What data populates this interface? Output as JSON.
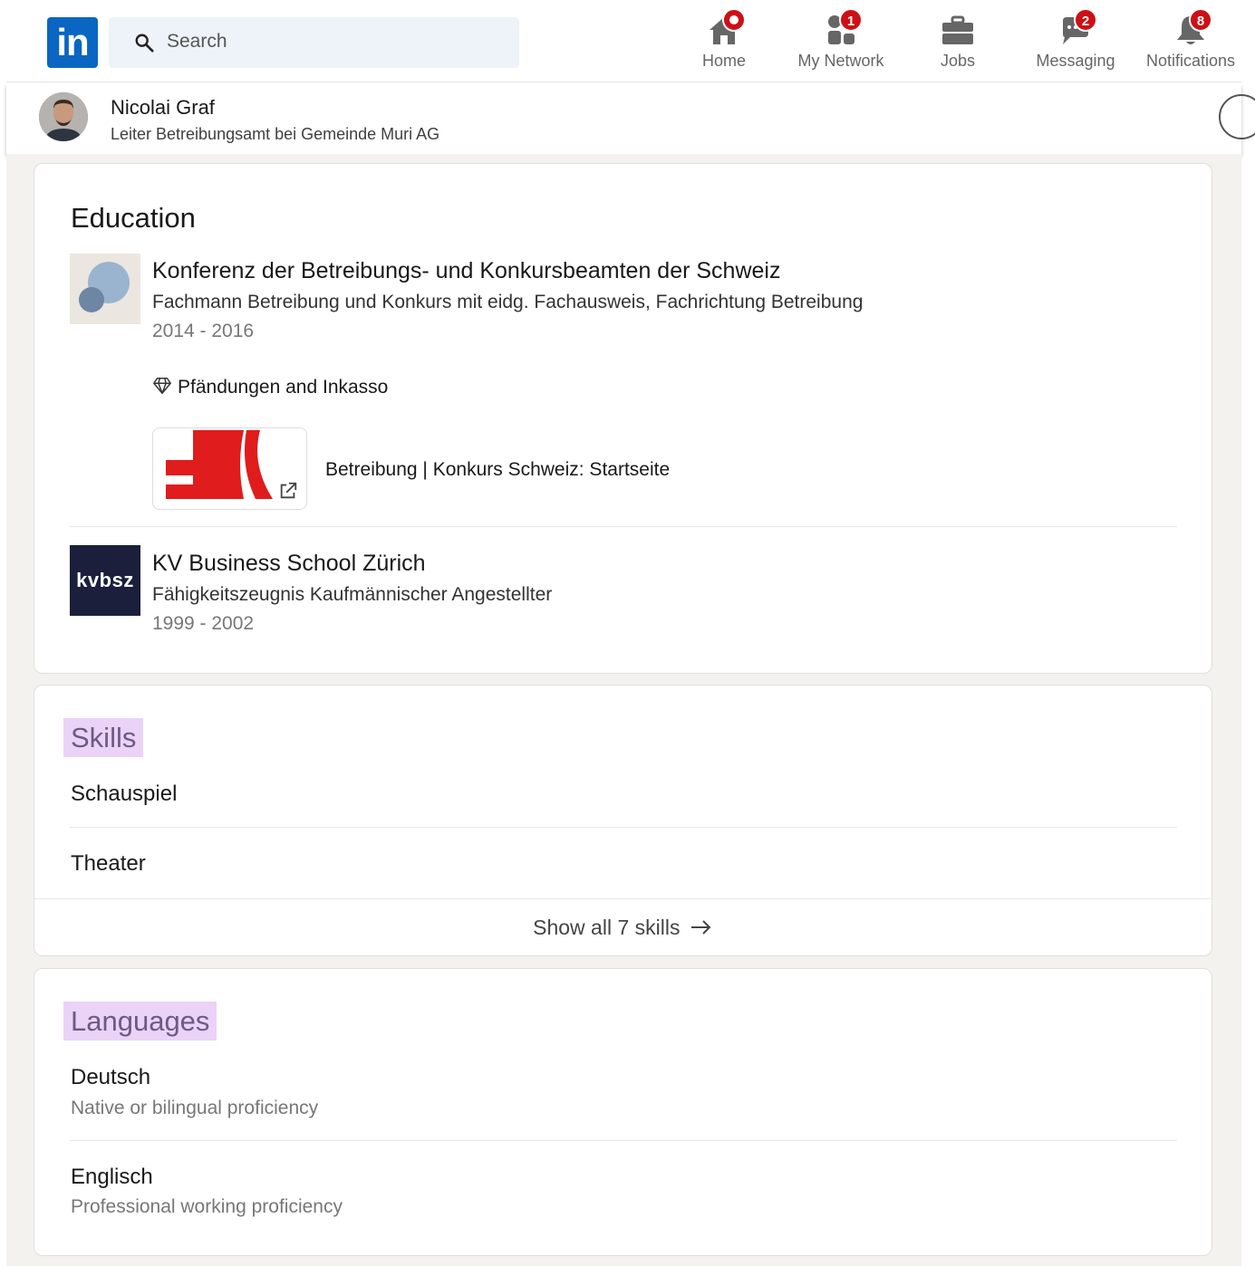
{
  "nav": {
    "logo_text": "in",
    "search_placeholder": "Search",
    "items": [
      {
        "label": "Home",
        "icon": "home-icon",
        "badge": ""
      },
      {
        "label": "My Network",
        "icon": "network-icon",
        "badge": "1"
      },
      {
        "label": "Jobs",
        "icon": "briefcase-icon",
        "badge": ""
      },
      {
        "label": "Messaging",
        "icon": "messaging-icon",
        "badge": "2"
      },
      {
        "label": "Notifications",
        "icon": "bell-icon",
        "badge": "8"
      }
    ]
  },
  "profile": {
    "name": "Nicolai Graf",
    "headline": "Leiter Betreibungsamt bei Gemeinde Muri AG"
  },
  "education": {
    "title": "Education",
    "entries": [
      {
        "school": "Konferenz der Betreibungs- und Konkursbeamten der Schweiz",
        "degree": "Fachmann Betreibung und Konkurs mit eidg. Fachausweis, Fachrichtung Betreibung",
        "dates": "2014 - 2016",
        "skill": "Pfändungen and Inkasso",
        "media_title": "Betreibung | Konkurs Schweiz: Startseite"
      },
      {
        "school": "KV Business School Zürich",
        "logo_text": "kvbsz",
        "degree": "Fähigkeitszeugnis Kaufmännischer Angestellter",
        "dates": "1999 - 2002"
      }
    ]
  },
  "skills": {
    "title": "Skills",
    "items": [
      "Schauspiel",
      "Theater"
    ],
    "show_all": "Show all 7 skills"
  },
  "languages": {
    "title": "Languages",
    "items": [
      {
        "name": "Deutsch",
        "proficiency": "Native or bilingual proficiency"
      },
      {
        "name": "Englisch",
        "proficiency": "Professional working proficiency"
      }
    ]
  },
  "colors": {
    "brand": "#0a66c2",
    "badge": "#cc1016",
    "highlight": "#ead3f7"
  }
}
